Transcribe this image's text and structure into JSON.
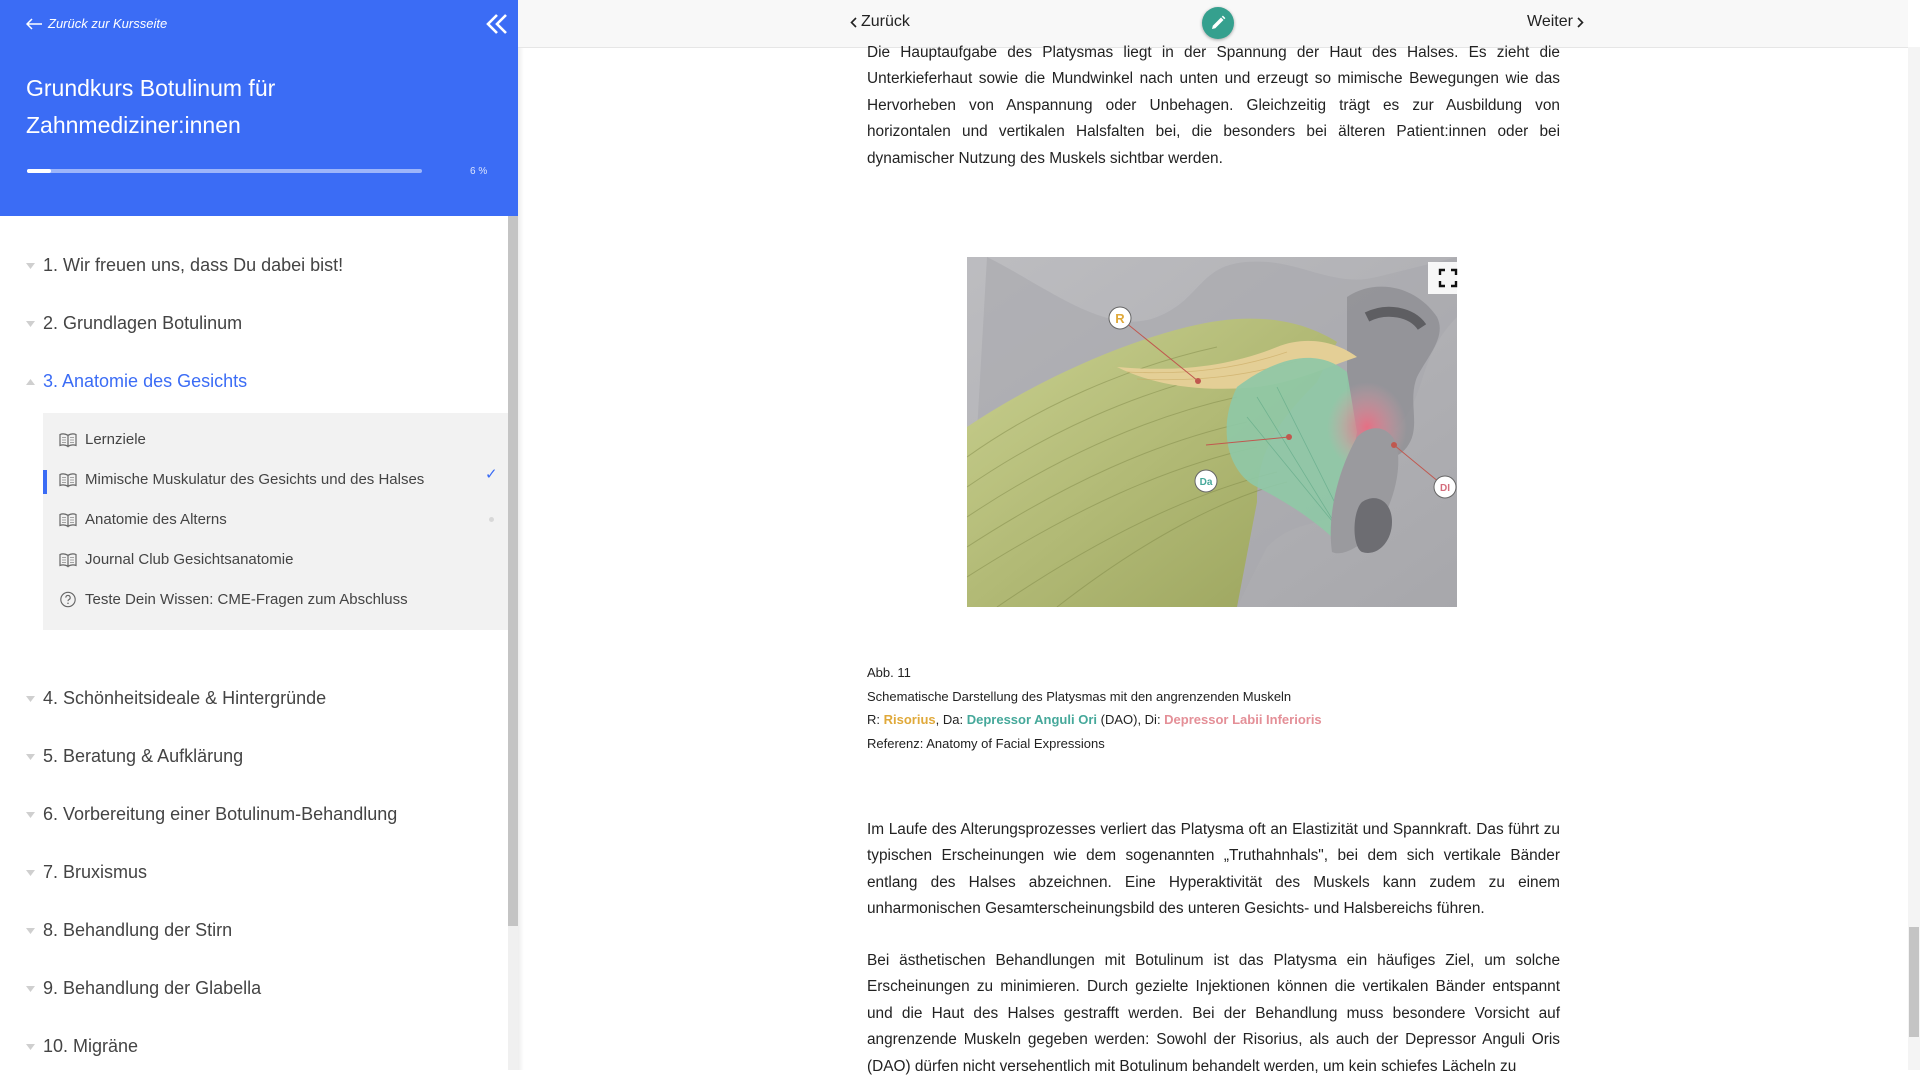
{
  "sidebar": {
    "back_label": "Zurück zur Kursseite",
    "course_title": "Grundkurs Botulinum für Zahnmediziner:innen",
    "progress_text": "6 %",
    "progress_value": 0.06,
    "chapters": [
      {
        "label": "1. Wir freuen uns, dass Du dabei bist!"
      },
      {
        "label": "2. Grundlagen Botulinum"
      },
      {
        "label": "3. Anatomie des Gesichts"
      },
      {
        "label": "4. Schönheitsideale & Hintergründe"
      },
      {
        "label": "5. Beratung & Aufklärung"
      },
      {
        "label": "6. Vorbereitung einer Botulinum-Behandlung"
      },
      {
        "label": "7. Bruxismus"
      },
      {
        "label": "8. Behandlung der Stirn"
      },
      {
        "label": "9. Behandlung der Glabella"
      },
      {
        "label": "10. Migräne"
      }
    ],
    "subitems": [
      {
        "label": "Lernziele",
        "icon": "book-icon"
      },
      {
        "label": "Mimische Muskulatur des Gesichts und des Halses",
        "icon": "book-icon",
        "status": "✓"
      },
      {
        "label": "Anatomie des Alterns",
        "icon": "book-icon"
      },
      {
        "label": "Journal Club Gesichtsanatomie",
        "icon": "book-icon"
      },
      {
        "label": "Teste Dein Wissen: CME-Fragen zum Abschluss",
        "icon": "question-circle-icon"
      }
    ]
  },
  "nav": {
    "prev_label": "Zurück",
    "next_label": "Weiter"
  },
  "content": {
    "para1": "Die Hauptaufgabe des Platysmas liegt in der Spannung der Haut des Halses. Es zieht die Unterkieferhaut sowie die Mundwinkel nach unten und erzeugt so mimische Bewegungen wie das Hervorheben von Anspannung oder Unbehagen. Gleichzeitig trägt es zur Ausbildung von horizontalen und vertikalen Halsfalten bei, die besonders bei älteren Patient:innen oder bei dynamischer Nutzung des Muskels sichtbar werden.",
    "figure": {
      "markers": [
        "R",
        "Da",
        "DI"
      ],
      "caption_number": "Abb. 11",
      "caption_title": "Schematische Darstellung des Platysmas mit den angrenzenden Muskeln",
      "legend_r_prefix": "R: ",
      "legend_r": "Risorius",
      "legend_da_prefix": ", Da: ",
      "legend_da": "Depressor Anguli Ori",
      "legend_di_prefix": " (DAO), Di: ",
      "legend_di": "Depressor Labii Inferioris",
      "reference": "Referenz: Anatomy of Facial Expressions"
    },
    "para2": "Im Laufe des Alterungsprozesses verliert das Platysma oft an Elastizität und Spannkraft. Das führt zu typischen Erscheinungen wie dem sogenannten „Truthahnhals\", bei dem sich vertikale Bänder entlang des Halses abzeichnen. Eine Hyperaktivität des Muskels kann zudem zu einem unharmonischen Gesamterscheinungsbild des unteren Gesichts- und Halsbereichs führen.",
    "para3": "Bei ästhetischen Behandlungen mit Botulinum ist das Platysma ein häufiges Ziel, um solche Erscheinungen zu minimieren. Durch gezielte Injektionen können die vertikalen Bänder entspannt und die Haut des Halses gestrafft werden. Bei der Behandlung muss besondere Vorsicht auf angrenzende Muskeln gegeben werden: Sowohl der Risorius, als auch der Depressor Anguli Oris (DAO) dürfen nicht versehentlich mit Botulinum behandelt werden, um kein schiefes Lächeln zu"
  },
  "colors": {
    "brand_blue": "#3b6cf5",
    "edit_green": "#35a08e",
    "risorius": "#e0a93a",
    "dao": "#45a89a",
    "dli": "#e48f97"
  }
}
